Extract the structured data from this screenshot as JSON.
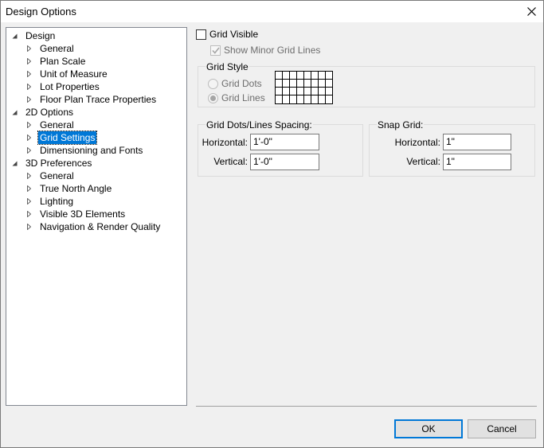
{
  "window": {
    "title": "Design Options"
  },
  "tree": {
    "items": [
      {
        "label": "Design",
        "level": 0,
        "expanded": true
      },
      {
        "label": "General",
        "level": 1
      },
      {
        "label": "Plan Scale",
        "level": 1
      },
      {
        "label": "Unit of Measure",
        "level": 1
      },
      {
        "label": "Lot Properties",
        "level": 1
      },
      {
        "label": "Floor Plan Trace Properties",
        "level": 1
      },
      {
        "label": "2D Options",
        "level": 0,
        "expanded": true
      },
      {
        "label": "General",
        "level": 1
      },
      {
        "label": "Grid Settings",
        "level": 1,
        "selected": true
      },
      {
        "label": "Dimensioning and Fonts",
        "level": 1
      },
      {
        "label": "3D Preferences",
        "level": 0,
        "expanded": true
      },
      {
        "label": "General",
        "level": 1
      },
      {
        "label": "True North Angle",
        "level": 1
      },
      {
        "label": "Lighting",
        "level": 1
      },
      {
        "label": "Visible 3D Elements",
        "level": 1
      },
      {
        "label": "Navigation & Render Quality",
        "level": 1
      }
    ]
  },
  "grid": {
    "visible_label": "Grid Visible",
    "minor_label": "Show Minor Grid Lines",
    "style_title": "Grid Style",
    "dots_label": "Grid Dots",
    "lines_label": "Grid Lines"
  },
  "spacing": {
    "title": "Grid Dots/Lines Spacing:",
    "horizontal_label": "Horizontal:",
    "horizontal_value": "1'-0\"",
    "vertical_label": "Vertical:",
    "vertical_value": "1'-0\""
  },
  "snap": {
    "title": "Snap Grid:",
    "horizontal_label": "Horizontal:",
    "horizontal_value": "1\"",
    "vertical_label": "Vertical:",
    "vertical_value": "1\""
  },
  "buttons": {
    "ok": "OK",
    "cancel": "Cancel"
  },
  "colors": {
    "selection": "#0078d7",
    "default_button_border": "#0078d7"
  }
}
